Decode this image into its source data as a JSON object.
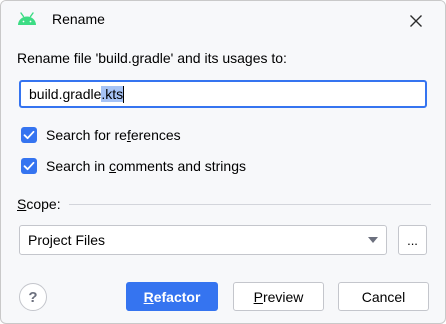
{
  "dialog": {
    "title": "Rename",
    "app_icon": "android-icon",
    "close_icon": "close-icon"
  },
  "prompt": "Rename file 'build.gradle' and its usages to:",
  "name_input": {
    "value_plain": "build.gradle",
    "value_selected": ".kts"
  },
  "options": {
    "search_references": {
      "checked": true,
      "label_pre": "Search for re",
      "label_mnemonic": "f",
      "label_post": "erences"
    },
    "search_comments": {
      "checked": true,
      "label_pre": "Search in ",
      "label_mnemonic": "c",
      "label_post": "omments and strings"
    }
  },
  "scope": {
    "label_mnemonic": "S",
    "label_post": "cope:",
    "selected": "Project Files",
    "browse_label": "..."
  },
  "buttons": {
    "help_label": "?",
    "refactor_mnemonic": "R",
    "refactor_post": "efactor",
    "preview_mnemonic": "P",
    "preview_post": "review",
    "cancel_label": "Cancel"
  },
  "colors": {
    "accent": "#3574f0",
    "selection": "#a6c3f5",
    "dialog_bg": "#f7f8fa"
  }
}
